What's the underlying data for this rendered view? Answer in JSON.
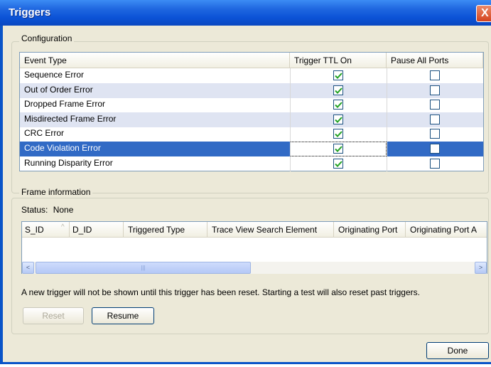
{
  "window": {
    "title": "Triggers",
    "close_glyph": "X"
  },
  "configuration": {
    "legend": "Configuration",
    "columns": [
      "Event Type",
      "Trigger TTL On",
      "Pause All Ports"
    ],
    "rows": [
      {
        "label": "Sequence Error",
        "ttl": true,
        "pause": false
      },
      {
        "label": "Out of Order Error",
        "ttl": true,
        "pause": false
      },
      {
        "label": "Dropped Frame Error",
        "ttl": true,
        "pause": false
      },
      {
        "label": "Misdirected Frame Error",
        "ttl": true,
        "pause": false
      },
      {
        "label": "CRC Error",
        "ttl": true,
        "pause": false
      },
      {
        "label": "Code Violation Error",
        "ttl": true,
        "pause": false,
        "selected": true
      },
      {
        "label": "Running Disparity Error",
        "ttl": true,
        "pause": false
      }
    ]
  },
  "frame_info": {
    "legend": "Frame information",
    "status_label": "Status:",
    "status_value": "None",
    "columns": [
      "S_ID",
      "D_ID",
      "Triggered Type",
      "Trace View Search Element",
      "Originating Port",
      "Originating Port A"
    ],
    "sort_glyph": "^",
    "scroll_left_glyph": "<",
    "scroll_right_glyph": ">",
    "thumb_grip": "|||",
    "note": "A new trigger will not be shown until this trigger has been reset. Starting a test will also reset past triggers.",
    "reset_label": "Reset",
    "resume_label": "Resume"
  },
  "footer": {
    "done_label": "Done"
  },
  "colors": {
    "titlebar": "#0a54c8",
    "selection": "#316ac5",
    "dialog_bg": "#ece9d8",
    "checkmark": "#21a121"
  }
}
